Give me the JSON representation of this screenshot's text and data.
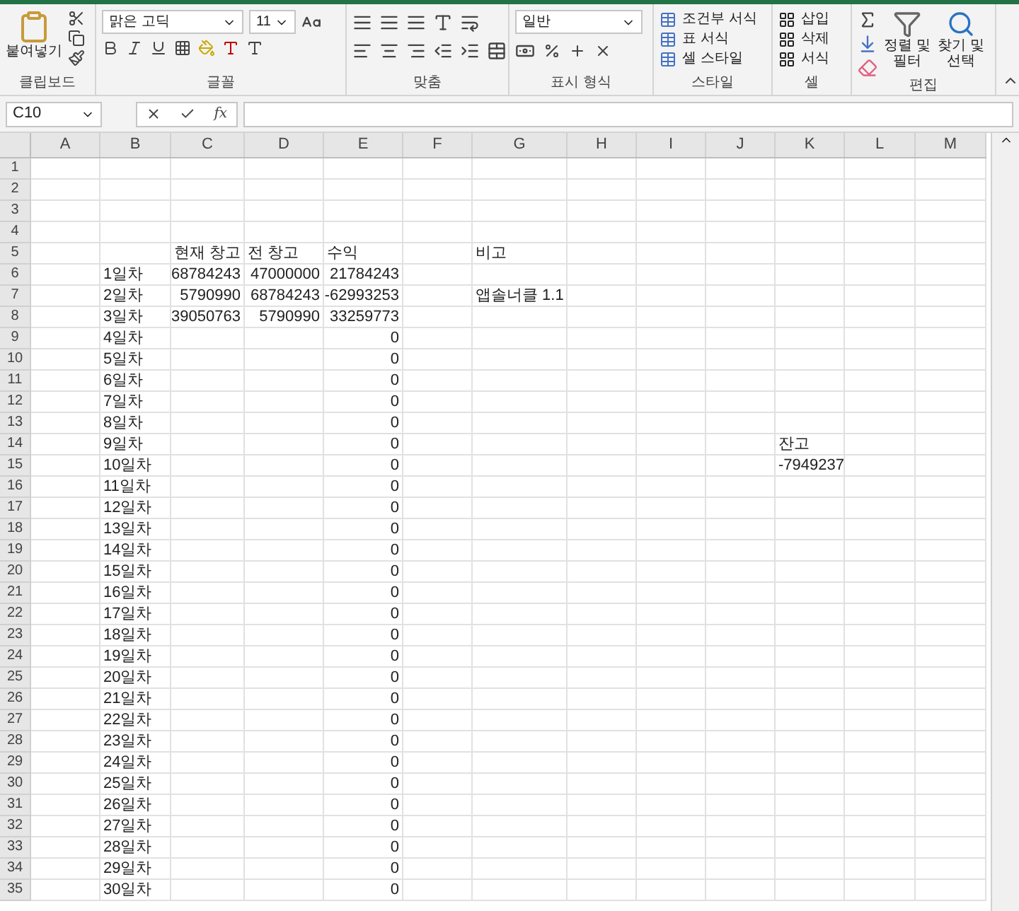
{
  "ribbon": {
    "clipboard": {
      "paste": "붙여넣기",
      "label": "클립보드"
    },
    "font": {
      "name": "맑은 고딕",
      "size": "11",
      "label": "글꼴"
    },
    "alignment": {
      "label": "맞춤"
    },
    "number": {
      "format": "일반",
      "label": "표시 형식"
    },
    "styles": {
      "items": [
        "조건부 서식",
        "표 서식",
        "셀 스타일"
      ],
      "label": "스타일"
    },
    "cells": {
      "items": [
        "삽입",
        "삭제",
        "서식"
      ],
      "label": "셀"
    },
    "editing": {
      "items": [
        "정렬 및 필터",
        "찾기 및 선택"
      ],
      "label": "편집"
    }
  },
  "formula_bar": {
    "name_box": "C10",
    "function_label": "fx"
  },
  "columns": [
    "A",
    "B",
    "C",
    "D",
    "E",
    "F",
    "G",
    "H",
    "I",
    "J",
    "K",
    "L",
    "M"
  ],
  "rows": [
    {
      "number": "1",
      "cells": [
        null,
        null,
        null,
        null,
        null,
        null,
        null,
        null,
        null,
        null,
        null,
        null,
        null
      ]
    },
    {
      "number": "2",
      "cells": [
        null,
        null,
        null,
        null,
        null,
        null,
        null,
        null,
        null,
        null,
        null,
        null,
        null
      ]
    },
    {
      "number": "3",
      "cells": [
        null,
        null,
        null,
        null,
        null,
        null,
        null,
        null,
        null,
        null,
        null,
        null,
        null
      ]
    },
    {
      "number": "4",
      "cells": [
        null,
        null,
        null,
        null,
        null,
        null,
        null,
        null,
        null,
        null,
        null,
        null,
        null
      ]
    },
    {
      "number": "5",
      "cells": [
        null,
        null,
        {
          "text": "현재 창고",
          "kind": "text"
        },
        {
          "text": "전 창고",
          "kind": "text"
        },
        {
          "text": "수익",
          "kind": "text"
        },
        null,
        {
          "text": "비고",
          "kind": "text"
        },
        null,
        null,
        null,
        null,
        null,
        null
      ]
    },
    {
      "number": "6",
      "cells": [
        null,
        {
          "text": "1일차",
          "kind": "text"
        },
        {
          "text": "68784243",
          "kind": "number"
        },
        {
          "text": "47000000",
          "kind": "number"
        },
        {
          "text": "21784243",
          "kind": "number"
        },
        null,
        null,
        null,
        null,
        null,
        null,
        null,
        null
      ]
    },
    {
      "number": "7",
      "cells": [
        null,
        {
          "text": "2일차",
          "kind": "text"
        },
        {
          "text": "5790990",
          "kind": "number"
        },
        {
          "text": "68784243",
          "kind": "number"
        },
        {
          "text": "-62993253",
          "kind": "number"
        },
        null,
        {
          "text": "앱솔너클 1.1",
          "kind": "text"
        },
        null,
        null,
        null,
        null,
        null,
        null
      ]
    },
    {
      "number": "8",
      "cells": [
        null,
        {
          "text": "3일차",
          "kind": "text"
        },
        {
          "text": "39050763",
          "kind": "number"
        },
        {
          "text": "5790990",
          "kind": "number"
        },
        {
          "text": "33259773",
          "kind": "number"
        },
        null,
        null,
        null,
        null,
        null,
        null,
        null,
        null
      ]
    },
    {
      "number": "9",
      "cells": [
        null,
        {
          "text": "4일차",
          "kind": "text"
        },
        null,
        null,
        {
          "text": "0",
          "kind": "number"
        },
        null,
        null,
        null,
        null,
        null,
        null,
        null,
        null
      ]
    },
    {
      "number": "10",
      "cells": [
        null,
        {
          "text": "5일차",
          "kind": "text"
        },
        null,
        null,
        {
          "text": "0",
          "kind": "number"
        },
        null,
        null,
        null,
        null,
        null,
        null,
        null,
        null
      ]
    },
    {
      "number": "11",
      "cells": [
        null,
        {
          "text": "6일차",
          "kind": "text"
        },
        null,
        null,
        {
          "text": "0",
          "kind": "number"
        },
        null,
        null,
        null,
        null,
        null,
        null,
        null,
        null
      ]
    },
    {
      "number": "12",
      "cells": [
        null,
        {
          "text": "7일차",
          "kind": "text"
        },
        null,
        null,
        {
          "text": "0",
          "kind": "number"
        },
        null,
        null,
        null,
        null,
        null,
        null,
        null,
        null
      ]
    },
    {
      "number": "13",
      "cells": [
        null,
        {
          "text": "8일차",
          "kind": "text"
        },
        null,
        null,
        {
          "text": "0",
          "kind": "number"
        },
        null,
        null,
        null,
        null,
        null,
        null,
        null,
        null
      ]
    },
    {
      "number": "14",
      "cells": [
        null,
        {
          "text": "9일차",
          "kind": "text"
        },
        null,
        null,
        {
          "text": "0",
          "kind": "number"
        },
        null,
        null,
        null,
        null,
        null,
        {
          "text": "잔고",
          "kind": "text"
        },
        null,
        null
      ]
    },
    {
      "number": "15",
      "cells": [
        null,
        {
          "text": "10일차",
          "kind": "text"
        },
        null,
        null,
        {
          "text": "0",
          "kind": "number"
        },
        null,
        null,
        null,
        null,
        null,
        {
          "text": "-7949237",
          "kind": "text"
        },
        null,
        null
      ]
    },
    {
      "number": "16",
      "cells": [
        null,
        {
          "text": "11일차",
          "kind": "text"
        },
        null,
        null,
        {
          "text": "0",
          "kind": "number"
        },
        null,
        null,
        null,
        null,
        null,
        null,
        null,
        null
      ]
    },
    {
      "number": "17",
      "cells": [
        null,
        {
          "text": "12일차",
          "kind": "text"
        },
        null,
        null,
        {
          "text": "0",
          "kind": "number"
        },
        null,
        null,
        null,
        null,
        null,
        null,
        null,
        null
      ]
    },
    {
      "number": "18",
      "cells": [
        null,
        {
          "text": "13일차",
          "kind": "text"
        },
        null,
        null,
        {
          "text": "0",
          "kind": "number"
        },
        null,
        null,
        null,
        null,
        null,
        null,
        null,
        null
      ]
    },
    {
      "number": "19",
      "cells": [
        null,
        {
          "text": "14일차",
          "kind": "text"
        },
        null,
        null,
        {
          "text": "0",
          "kind": "number"
        },
        null,
        null,
        null,
        null,
        null,
        null,
        null,
        null
      ]
    },
    {
      "number": "20",
      "cells": [
        null,
        {
          "text": "15일차",
          "kind": "text"
        },
        null,
        null,
        {
          "text": "0",
          "kind": "number"
        },
        null,
        null,
        null,
        null,
        null,
        null,
        null,
        null
      ]
    },
    {
      "number": "21",
      "cells": [
        null,
        {
          "text": "16일차",
          "kind": "text"
        },
        null,
        null,
        {
          "text": "0",
          "kind": "number"
        },
        null,
        null,
        null,
        null,
        null,
        null,
        null,
        null
      ]
    },
    {
      "number": "22",
      "cells": [
        null,
        {
          "text": "17일차",
          "kind": "text"
        },
        null,
        null,
        {
          "text": "0",
          "kind": "number"
        },
        null,
        null,
        null,
        null,
        null,
        null,
        null,
        null
      ]
    },
    {
      "number": "23",
      "cells": [
        null,
        {
          "text": "18일차",
          "kind": "text"
        },
        null,
        null,
        {
          "text": "0",
          "kind": "number"
        },
        null,
        null,
        null,
        null,
        null,
        null,
        null,
        null
      ]
    },
    {
      "number": "24",
      "cells": [
        null,
        {
          "text": "19일차",
          "kind": "text"
        },
        null,
        null,
        {
          "text": "0",
          "kind": "number"
        },
        null,
        null,
        null,
        null,
        null,
        null,
        null,
        null
      ]
    },
    {
      "number": "25",
      "cells": [
        null,
        {
          "text": "20일차",
          "kind": "text"
        },
        null,
        null,
        {
          "text": "0",
          "kind": "number"
        },
        null,
        null,
        null,
        null,
        null,
        null,
        null,
        null
      ]
    },
    {
      "number": "26",
      "cells": [
        null,
        {
          "text": "21일차",
          "kind": "text"
        },
        null,
        null,
        {
          "text": "0",
          "kind": "number"
        },
        null,
        null,
        null,
        null,
        null,
        null,
        null,
        null
      ]
    },
    {
      "number": "27",
      "cells": [
        null,
        {
          "text": "22일차",
          "kind": "text"
        },
        null,
        null,
        {
          "text": "0",
          "kind": "number"
        },
        null,
        null,
        null,
        null,
        null,
        null,
        null,
        null
      ]
    },
    {
      "number": "28",
      "cells": [
        null,
        {
          "text": "23일차",
          "kind": "text"
        },
        null,
        null,
        {
          "text": "0",
          "kind": "number"
        },
        null,
        null,
        null,
        null,
        null,
        null,
        null,
        null
      ]
    },
    {
      "number": "29",
      "cells": [
        null,
        {
          "text": "24일차",
          "kind": "text"
        },
        null,
        null,
        {
          "text": "0",
          "kind": "number"
        },
        null,
        null,
        null,
        null,
        null,
        null,
        null,
        null
      ]
    },
    {
      "number": "30",
      "cells": [
        null,
        {
          "text": "25일차",
          "kind": "text"
        },
        null,
        null,
        {
          "text": "0",
          "kind": "number"
        },
        null,
        null,
        null,
        null,
        null,
        null,
        null,
        null
      ]
    },
    {
      "number": "31",
      "cells": [
        null,
        {
          "text": "26일차",
          "kind": "text"
        },
        null,
        null,
        {
          "text": "0",
          "kind": "number"
        },
        null,
        null,
        null,
        null,
        null,
        null,
        null,
        null
      ]
    },
    {
      "number": "32",
      "cells": [
        null,
        {
          "text": "27일차",
          "kind": "text"
        },
        null,
        null,
        {
          "text": "0",
          "kind": "number"
        },
        null,
        null,
        null,
        null,
        null,
        null,
        null,
        null
      ]
    },
    {
      "number": "33",
      "cells": [
        null,
        {
          "text": "28일차",
          "kind": "text"
        },
        null,
        null,
        {
          "text": "0",
          "kind": "number"
        },
        null,
        null,
        null,
        null,
        null,
        null,
        null,
        null
      ]
    },
    {
      "number": "34",
      "cells": [
        null,
        {
          "text": "29일차",
          "kind": "text"
        },
        null,
        null,
        {
          "text": "0",
          "kind": "number"
        },
        null,
        null,
        null,
        null,
        null,
        null,
        null,
        null
      ]
    },
    {
      "number": "35",
      "cells": [
        null,
        {
          "text": "30일차",
          "kind": "text"
        },
        null,
        null,
        {
          "text": "0",
          "kind": "number"
        },
        null,
        null,
        null,
        null,
        null,
        null,
        null,
        null
      ]
    }
  ]
}
